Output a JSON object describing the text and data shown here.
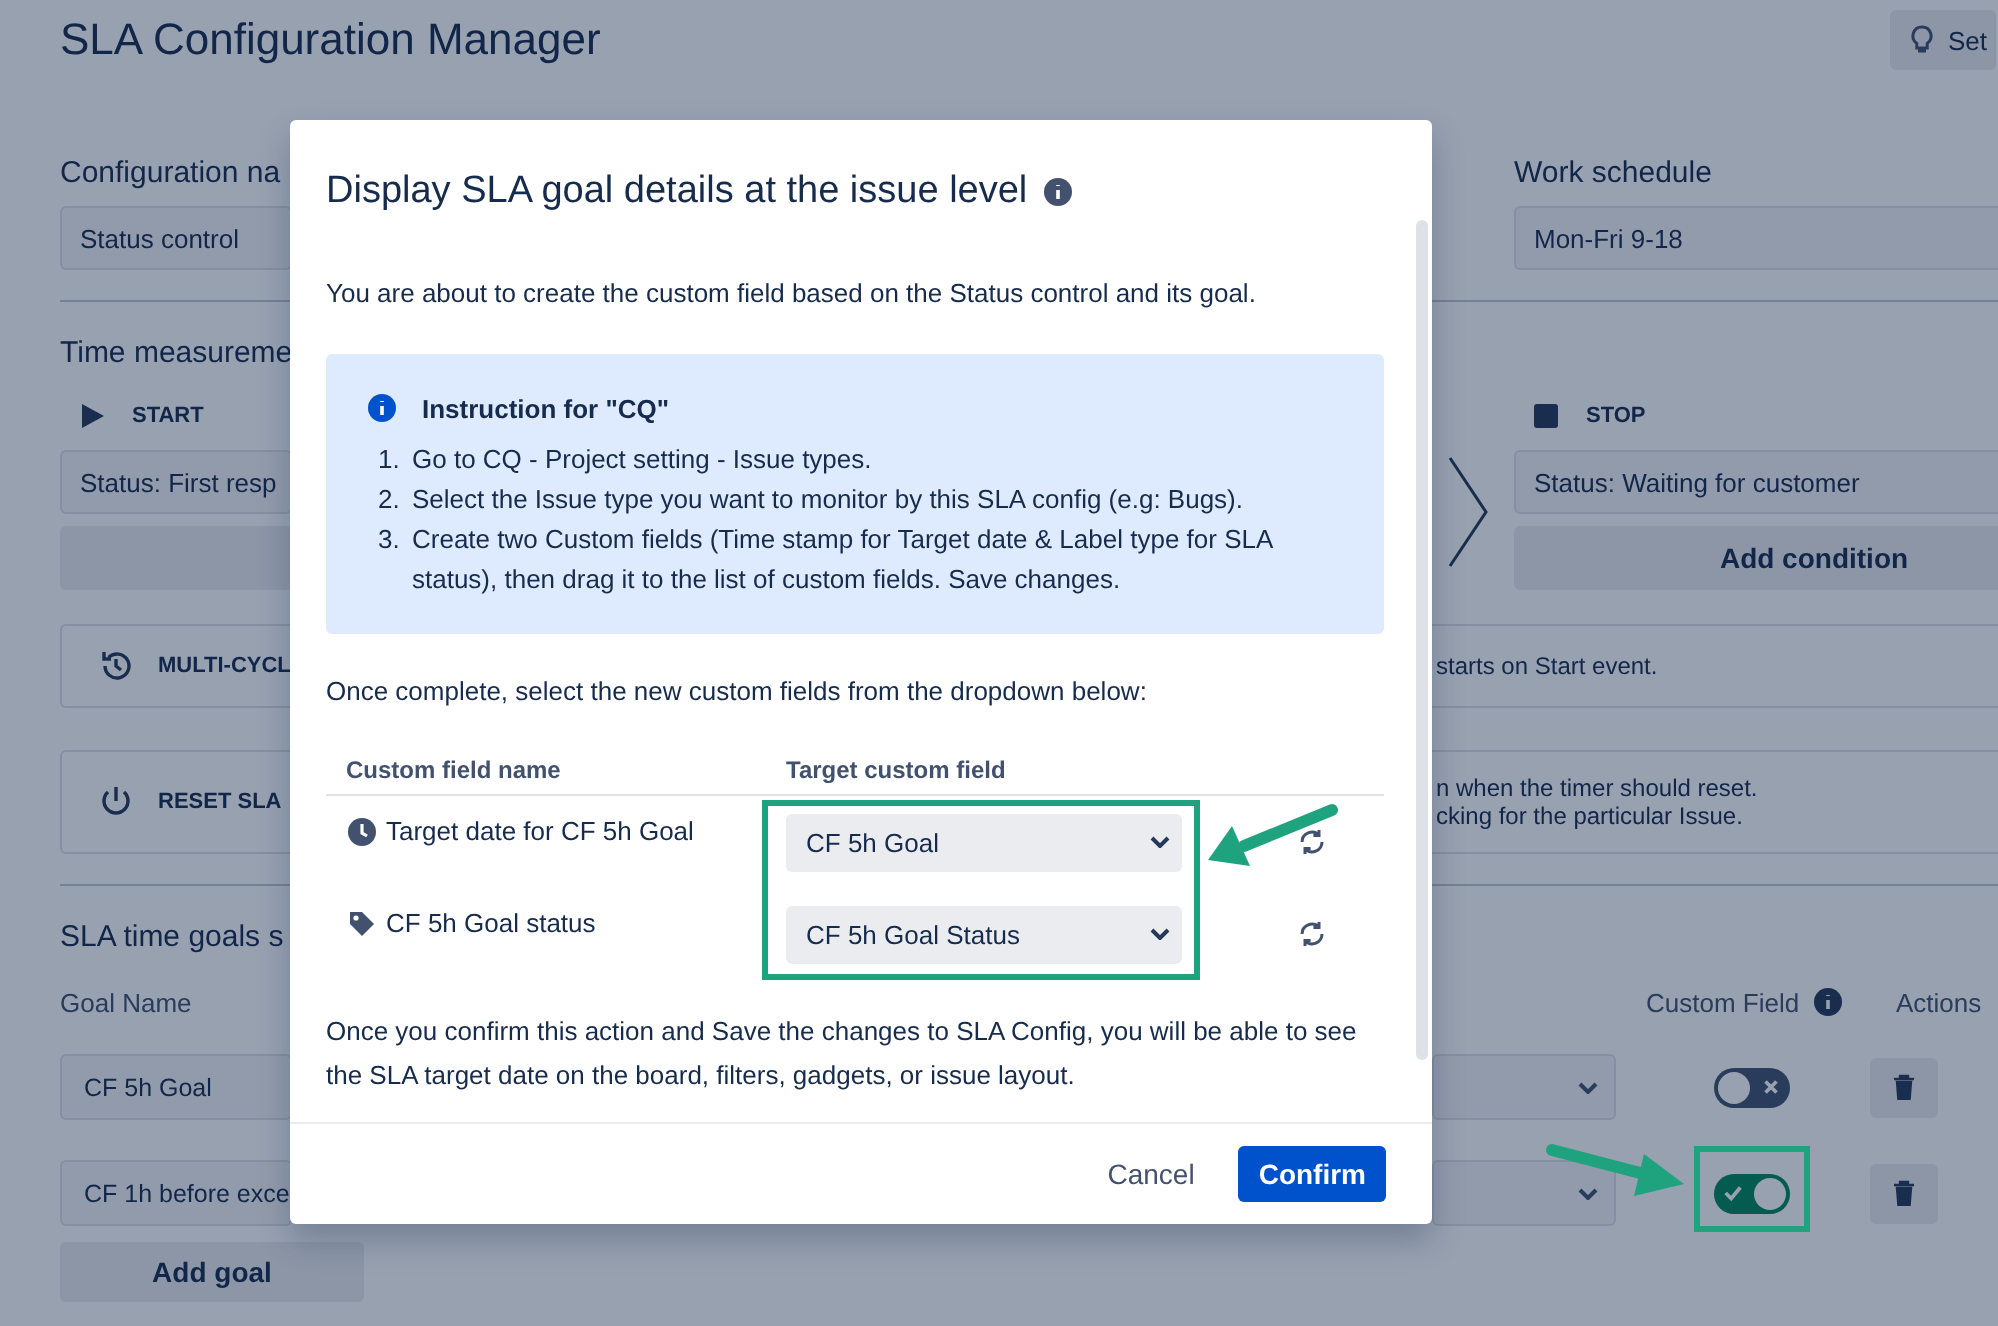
{
  "page": {
    "title": "SLA Configuration Manager",
    "top_button": "Set"
  },
  "config": {
    "name_label": "Configuration na",
    "name_value": "Status control",
    "schedule_label": "Work schedule",
    "schedule_value": "Mon-Fri 9-18"
  },
  "time": {
    "label": "Time measureme",
    "start": {
      "label": "START",
      "value": "Status: First resp"
    },
    "stop": {
      "label": "STOP",
      "value": "Status: Waiting for customer",
      "button": "Add condition"
    }
  },
  "options": [
    {
      "kind": "multi-cycle",
      "label": "MULTI-CYCL",
      "lines": [
        "starts on Start event."
      ]
    },
    {
      "kind": "reset",
      "label": "RESET SLA",
      "lines": [
        "n when the timer should reset.",
        "cking for the particular Issue."
      ]
    }
  ],
  "goals": {
    "title": "SLA time goals s",
    "columns": [
      "Goal Name",
      "Custom Field",
      "Actions"
    ],
    "rows": [
      {
        "name": "CF 5h Goal",
        "custom_field_on": false
      },
      {
        "name": "CF 1h before exce",
        "custom_field_on": true
      }
    ],
    "add_button": "Add goal"
  },
  "dialog": {
    "title": "Display SLA goal details at the issue level",
    "intro": "You are about to create the custom field based on the Status control and its goal.",
    "instruction": {
      "title": "Instruction for \"CQ\"",
      "steps": [
        {
          "number": "1.",
          "text": "Go to CQ - Project setting - Issue types."
        },
        {
          "number": "2.",
          "text": "Select the Issue type you want to monitor by this SLA config (e.g: Bugs)."
        },
        {
          "number": "3.",
          "text": "Create two Custom fields (Time stamp for Target date & Label type for SLA status), then drag it to the list of custom fields. Save changes."
        }
      ]
    },
    "prompt": "Once complete, select the new custom fields from the dropdown below:",
    "table": {
      "columns": [
        "Custom field name",
        "Target custom field"
      ],
      "rows": [
        {
          "kind": "date",
          "name": "Target date for CF 5h Goal",
          "value": "CF 5h Goal"
        },
        {
          "kind": "label",
          "name": "CF 5h Goal status",
          "value": "CF 5h Goal Status"
        }
      ]
    },
    "note": "Once you confirm this action and Save the changes to SLA Config, you will be able to see the SLA target date on the board, filters, gadgets, or issue layout.",
    "buttons": {
      "cancel": "Cancel",
      "confirm": "Confirm"
    }
  }
}
